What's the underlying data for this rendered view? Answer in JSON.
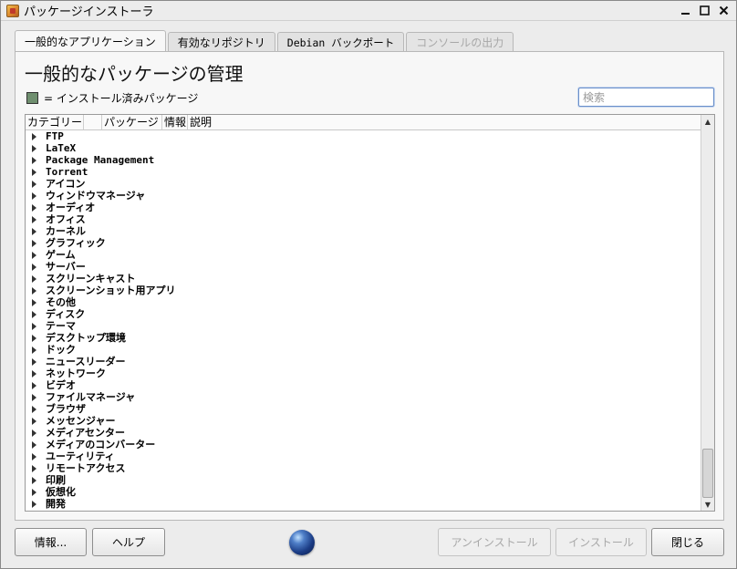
{
  "window": {
    "title": "パッケージインストーラ",
    "controls": [
      "minimize",
      "maximize",
      "close"
    ]
  },
  "tabs": [
    {
      "label": "一般的なアプリケーション",
      "active": true,
      "disabled": false
    },
    {
      "label": "有効なリポジトリ",
      "active": false,
      "disabled": false
    },
    {
      "label": "Debian バックポート",
      "active": false,
      "disabled": false
    },
    {
      "label": "コンソールの出力",
      "active": false,
      "disabled": true
    }
  ],
  "main": {
    "heading": "一般的なパッケージの管理",
    "legend_text": "= インストール済みパッケージ",
    "legend_color": "#6f8f6f",
    "search_placeholder": "検索"
  },
  "tree": {
    "columns": [
      "カテゴリー",
      "",
      "パッケージ",
      "情報",
      "説明"
    ],
    "rows": [
      "FTP",
      "LaTeX",
      "Package Management",
      "Torrent",
      "アイコン",
      "ウィンドウマネージャ",
      "オーディオ",
      "オフィス",
      "カーネル",
      "グラフィック",
      "ゲーム",
      "サーバー",
      "スクリーンキャスト",
      "スクリーンショット用アプリ",
      "その他",
      "ディスク",
      "テーマ",
      "デスクトップ環境",
      "ドック",
      "ニュースリーダー",
      "ネットワーク",
      "ビデオ",
      "ファイルマネージャ",
      "ブラウザ",
      "メッセンジャー",
      "メディアセンター",
      "メディアのコンバーター",
      "ユーティリティ",
      "リモートアクセス",
      "印刷",
      "仮想化",
      "開発"
    ]
  },
  "buttons": {
    "info": "情報...",
    "help": "ヘルプ",
    "uninstall": "アンインストール",
    "install": "インストール",
    "close": "閉じる"
  },
  "icons": {
    "app": "package-installer-icon",
    "status": "globe-icon"
  }
}
